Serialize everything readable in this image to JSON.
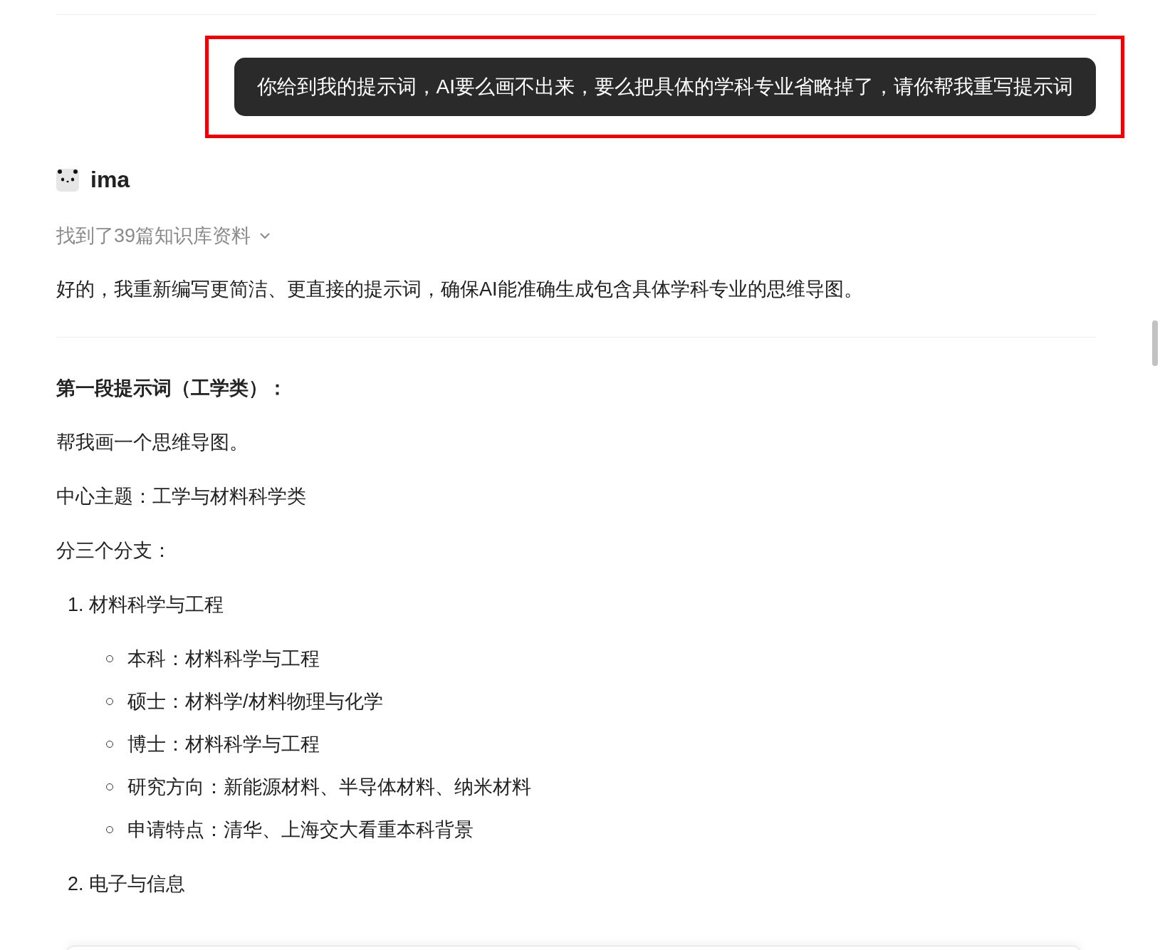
{
  "user_message": {
    "text": "你给到我的提示词，AI要么画不出来，要么把具体的学科专业省略掉了，请你帮我重写提示词",
    "highlighted": true
  },
  "assistant": {
    "name": "ima",
    "sources": {
      "label": "找到了39篇知识库资料",
      "expanded": false
    },
    "intro": "好的，我重新编写更简洁、更直接的提示词，确保AI能准确生成包含具体学科专业的思维导图。",
    "heading": "第一段提示词（工学类）：",
    "paragraphs": [
      "帮我画一个思维导图。",
      "中心主题：工学与材料科学类",
      "分三个分支："
    ],
    "items": [
      {
        "number": "1.",
        "title": "材料科学与工程",
        "children": [
          "本科：材料科学与工程",
          "硕士：材料学/材料物理与化学",
          "博士：材料科学与工程",
          "研究方向：新能源材料、半导体材料、纳米材料",
          "申请特点：清华、上海交大看重本科背景"
        ]
      },
      {
        "number": "2.",
        "title": "电子与信息"
      }
    ]
  }
}
